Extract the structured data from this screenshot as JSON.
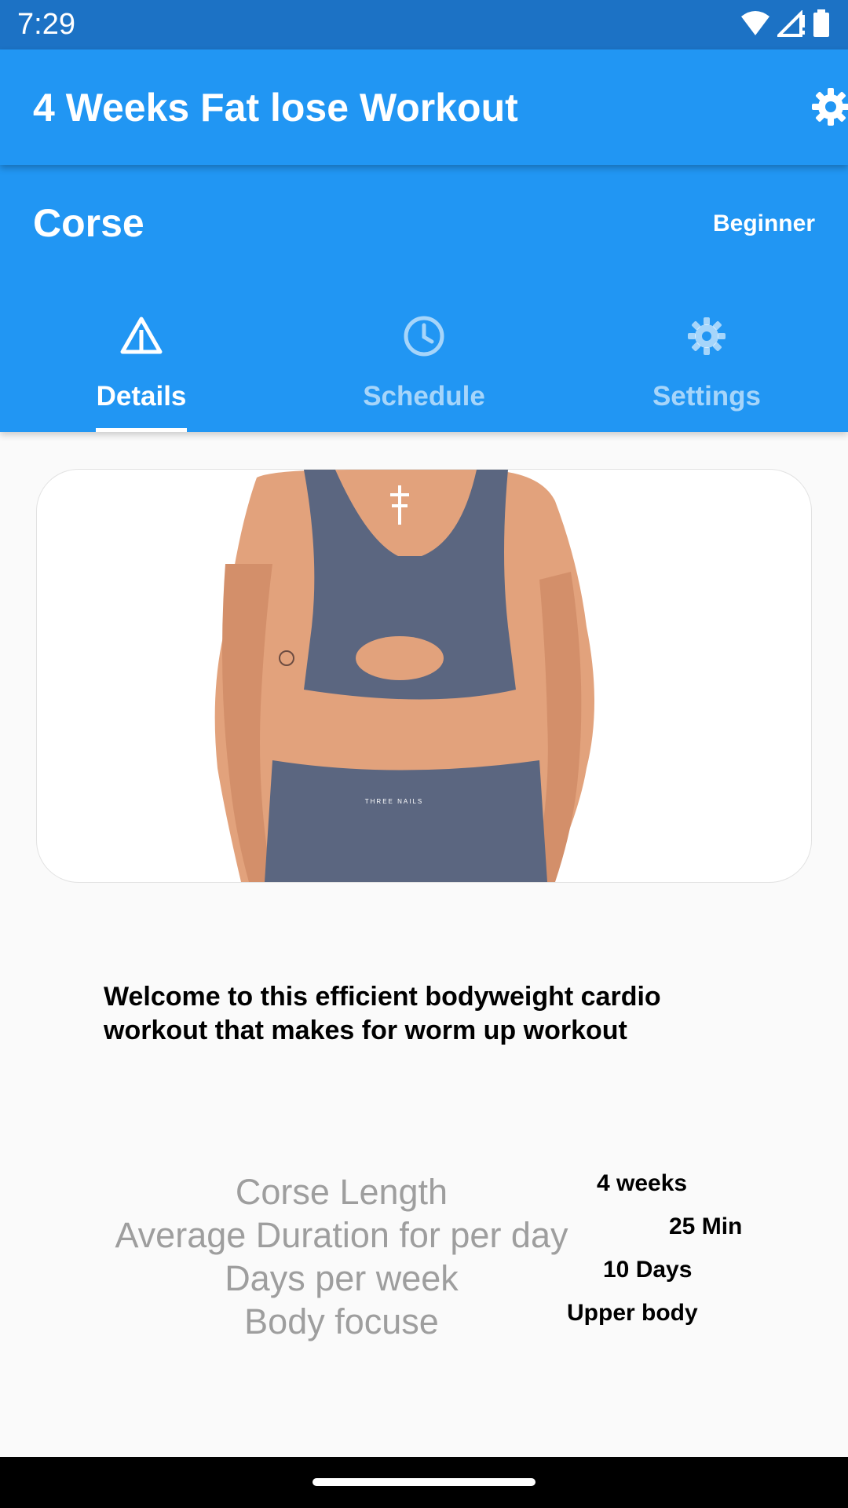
{
  "status_bar": {
    "time": "7:29",
    "icons": [
      "wifi-icon",
      "signal-icon",
      "battery-icon"
    ]
  },
  "app_bar": {
    "title": "4 Weeks Fat lose Workout",
    "settings_icon": "gear-icon"
  },
  "course_header": {
    "title": "Corse",
    "level": "Beginner"
  },
  "tabs": [
    {
      "label": "Details",
      "icon": "warning-triangle-icon",
      "active": true
    },
    {
      "label": "Schedule",
      "icon": "clock-icon",
      "active": false
    },
    {
      "label": "Settings",
      "icon": "gear-icon",
      "active": false
    }
  ],
  "hero_image": {
    "description_icon": "workout-photo",
    "print_text": "THREE NAILS"
  },
  "welcome_text": "Welcome to this efficient bodyweight cardio workout that makes for worm up workout",
  "stats": [
    {
      "label": "Corse Length",
      "value": "4 weeks"
    },
    {
      "label": "Average Duration for per day",
      "value": "25 Min"
    },
    {
      "label": "Days per week",
      "value": "10 Days"
    },
    {
      "label": "Body focuse",
      "value": "Upper body"
    }
  ],
  "colors": {
    "primary": "#2196f3",
    "status_bar": "#1c72c5",
    "background": "#fafafa",
    "muted_text": "#9e9e9e"
  }
}
